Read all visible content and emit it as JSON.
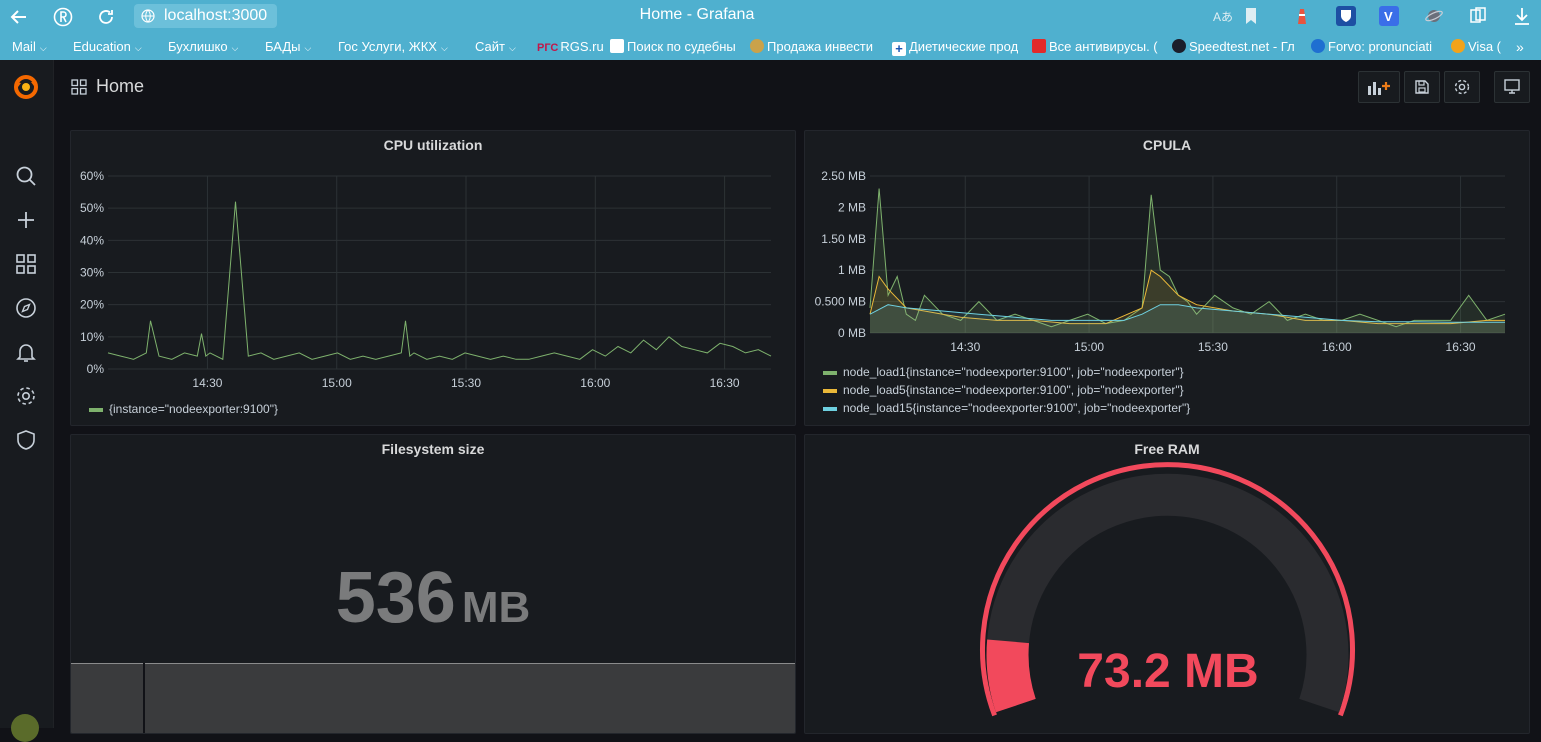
{
  "browser": {
    "url": "localhost:3000",
    "window_title": "Home - Grafana"
  },
  "bookmarks": [
    {
      "label": "Mail",
      "has_menu": true
    },
    {
      "label": "Education",
      "has_menu": true
    },
    {
      "label": "Бухлишко",
      "has_menu": true
    },
    {
      "label": "БАДы",
      "has_menu": true
    },
    {
      "label": "Гос Услуги, ЖКХ",
      "has_menu": true
    },
    {
      "label": "Сайт",
      "has_menu": true
    },
    {
      "label": "RGS.ru",
      "has_menu": false
    },
    {
      "label": "Поиск по судебны",
      "has_menu": false
    },
    {
      "label": "Продажа инвести",
      "has_menu": false
    },
    {
      "label": "Диетические прод",
      "has_menu": false
    },
    {
      "label": "Все антивирусы. (",
      "has_menu": false
    },
    {
      "label": "Speedtest.net - Гл",
      "has_menu": false
    },
    {
      "label": "Forvo: pronunciati",
      "has_menu": false
    },
    {
      "label": "Visa (",
      "has_menu": false
    }
  ],
  "bookmark_badges": {
    "rgs": "РГС"
  },
  "header": {
    "title": "Home"
  },
  "panels": {
    "cpu": {
      "title": "CPU utilization",
      "legend": "{instance=\"nodeexporter:9100\"}"
    },
    "cpula": {
      "title": "CPULA",
      "legend": [
        "node_load1{instance=\"nodeexporter:9100\", job=\"nodeexporter\"}",
        "node_load5{instance=\"nodeexporter:9100\", job=\"nodeexporter\"}",
        "node_load15{instance=\"nodeexporter:9100\", job=\"nodeexporter\"}"
      ]
    },
    "fs": {
      "title": "Filesystem size",
      "value": "536",
      "unit": "MB"
    },
    "ram": {
      "title": "Free RAM",
      "value": "73.2 MB"
    }
  },
  "colors": {
    "series_green": "#7eb26d",
    "series_yellow": "#eab839",
    "series_blue": "#6ed0e0",
    "gauge_red": "#f2495c",
    "browser_bar": "#4fb0cf"
  },
  "chart_data": [
    {
      "type": "line",
      "title": "CPU utilization",
      "x_ticks": [
        "14:30",
        "15:00",
        "15:30",
        "16:00",
        "16:30"
      ],
      "y_ticks": [
        "0%",
        "10%",
        "20%",
        "30%",
        "40%",
        "50%",
        "60%"
      ],
      "ylim": [
        0,
        60
      ],
      "series": [
        {
          "name": "{instance=\"nodeexporter:9100\"}",
          "color": "#7eb26d",
          "x": [
            0,
            3,
            6,
            9,
            10,
            12,
            15,
            18,
            21,
            22,
            23,
            24,
            27,
            30,
            33,
            36,
            39,
            42,
            45,
            48,
            51,
            54,
            57,
            60,
            63,
            66,
            69,
            70,
            71,
            72,
            75,
            78,
            81,
            84,
            87,
            90,
            93,
            96,
            99,
            102,
            105,
            108,
            111,
            114,
            117,
            120,
            123,
            126,
            129,
            132,
            135,
            138,
            141,
            144,
            147,
            150,
            153,
            156
          ],
          "y": [
            5,
            4,
            3,
            5,
            15,
            4,
            3,
            5,
            4,
            11,
            4,
            5,
            3,
            52,
            4,
            5,
            3,
            4,
            5,
            3,
            4,
            5,
            3,
            4,
            3,
            4,
            5,
            15,
            4,
            5,
            3,
            4,
            3,
            5,
            4,
            3,
            4,
            3,
            3,
            4,
            5,
            4,
            3,
            6,
            4,
            7,
            5,
            9,
            6,
            10,
            7,
            6,
            5,
            8,
            7,
            5,
            6,
            4
          ]
        }
      ]
    },
    {
      "type": "area",
      "title": "CPULA",
      "x_ticks": [
        "14:30",
        "15:00",
        "15:30",
        "16:00",
        "16:30"
      ],
      "y_ticks": [
        "0 MB",
        "0.500 MB",
        "1 MB",
        "1.50 MB",
        "2 MB",
        "2.50 MB"
      ],
      "ylim": [
        0,
        2.5
      ],
      "series": [
        {
          "name": "node_load1{instance=\"nodeexporter:9100\", job=\"nodeexporter\"}",
          "color": "#7eb26d",
          "x": [
            0,
            1,
            2,
            3,
            4,
            5,
            6,
            8,
            10,
            12,
            14,
            16,
            18,
            20,
            22,
            24,
            26,
            28,
            30,
            31,
            32,
            33,
            34,
            35,
            36,
            38,
            40,
            42,
            44,
            46,
            48,
            50,
            52,
            54,
            56,
            58,
            60,
            62,
            64,
            66,
            68,
            70
          ],
          "y": [
            0.4,
            2.3,
            0.6,
            0.9,
            0.3,
            0.2,
            0.6,
            0.3,
            0.2,
            0.5,
            0.2,
            0.3,
            0.2,
            0.1,
            0.2,
            0.3,
            0.15,
            0.2,
            0.4,
            2.2,
            1.0,
            0.9,
            0.6,
            0.5,
            0.3,
            0.6,
            0.4,
            0.3,
            0.5,
            0.2,
            0.3,
            0.2,
            0.2,
            0.3,
            0.2,
            0.1,
            0.2,
            0.2,
            0.2,
            0.6,
            0.2,
            0.3
          ]
        },
        {
          "name": "node_load5{instance=\"nodeexporter:9100\", job=\"nodeexporter\"}",
          "color": "#eab839",
          "x": [
            0,
            1,
            2,
            4,
            6,
            8,
            10,
            14,
            18,
            22,
            26,
            30,
            31,
            32,
            34,
            36,
            40,
            44,
            48,
            52,
            56,
            60,
            64,
            68,
            70
          ],
          "y": [
            0.3,
            0.9,
            0.7,
            0.4,
            0.35,
            0.3,
            0.25,
            0.2,
            0.2,
            0.15,
            0.15,
            0.4,
            1.0,
            0.9,
            0.6,
            0.45,
            0.35,
            0.3,
            0.2,
            0.2,
            0.15,
            0.15,
            0.15,
            0.2,
            0.2
          ]
        },
        {
          "name": "node_load15{instance=\"nodeexporter:9100\", job=\"nodeexporter\"}",
          "color": "#6ed0e0",
          "x": [
            0,
            2,
            4,
            8,
            12,
            16,
            20,
            24,
            28,
            30,
            32,
            34,
            36,
            40,
            44,
            48,
            52,
            56,
            60,
            64,
            68,
            70
          ],
          "y": [
            0.3,
            0.45,
            0.4,
            0.35,
            0.3,
            0.25,
            0.2,
            0.2,
            0.2,
            0.3,
            0.45,
            0.45,
            0.4,
            0.35,
            0.3,
            0.25,
            0.2,
            0.18,
            0.18,
            0.17,
            0.17,
            0.17
          ]
        }
      ]
    }
  ]
}
